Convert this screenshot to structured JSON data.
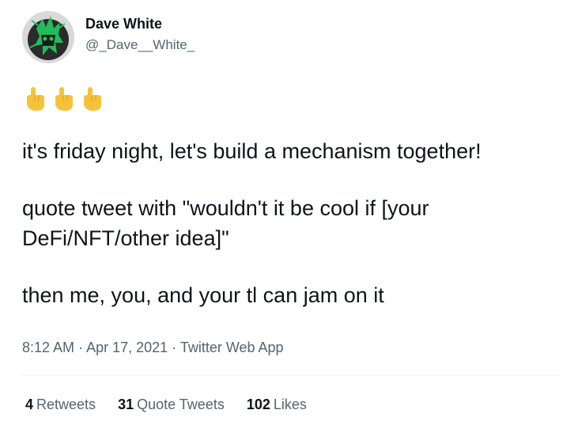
{
  "author": {
    "display_name": "Dave White",
    "handle": "@_Dave__White_"
  },
  "emojis": [
    "pointing-down-hand",
    "pointing-down-hand",
    "pointing-down-hand"
  ],
  "tweet": {
    "line1": "it's friday night, let's build a mechanism together!",
    "line2a": "quote tweet with \"wouldn't it be cool if [your",
    "line2b": "DeFi/NFT/other idea]\"",
    "line3": "then me, you, and your tl can jam on it"
  },
  "meta": {
    "time": "8:12 AM",
    "sep1": " · ",
    "date": "Apr 17, 2021",
    "sep2": " · ",
    "source": "Twitter Web App"
  },
  "stats": {
    "retweets_count": "4",
    "retweets_label": "Retweets",
    "quotes_count": "31",
    "quotes_label": "Quote Tweets",
    "likes_count": "102",
    "likes_label": "Likes"
  },
  "colors": {
    "text": "#0f1419",
    "secondary": "#536471",
    "emoji": "#f5c33b",
    "avatar_accent": "#22c55e"
  }
}
